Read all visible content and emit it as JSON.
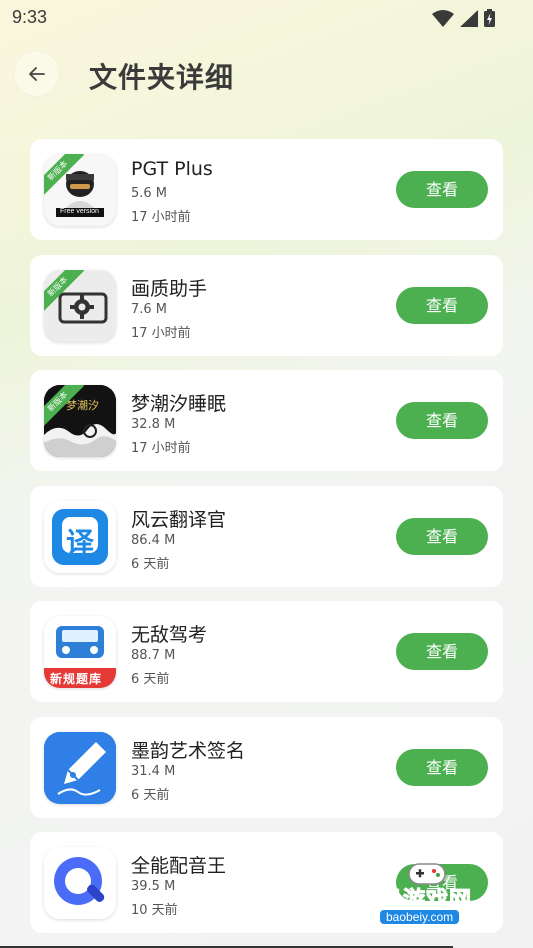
{
  "status": {
    "time": "9:33"
  },
  "header": {
    "title": "文件夹详细"
  },
  "apps": [
    {
      "name": "PGT Plus",
      "size": "5.6 M",
      "time": "17 小时前",
      "badge": "新版本",
      "icon": "pgt-plus-icon",
      "icon_caption": "Free version",
      "button": "查看"
    },
    {
      "name": "画质助手",
      "size": "7.6 M",
      "time": "17 小时前",
      "badge": "新版本",
      "icon": "gear-icon",
      "button": "查看"
    },
    {
      "name": "梦潮汐睡眠",
      "size": "32.8 M",
      "time": "17 小时前",
      "badge": "新版本",
      "icon": "wave-icon",
      "icon_caption": "梦潮汐",
      "button": "查看"
    },
    {
      "name": "风云翻译官",
      "size": "86.4 M",
      "time": "6 天前",
      "icon": "translate-icon",
      "icon_glyph": "译",
      "button": "查看"
    },
    {
      "name": "无敌驾考",
      "size": "88.7 M",
      "time": "6 天前",
      "icon": "car-icon",
      "icon_caption": "新规题库",
      "button": "查看"
    },
    {
      "name": "墨韵艺术签名",
      "size": "31.4 M",
      "time": "6 天前",
      "icon": "pen-icon",
      "button": "查看"
    },
    {
      "name": "全能配音王",
      "size": "39.5 M",
      "time": "10 天前",
      "icon": "dubbing-icon",
      "button": "查看"
    }
  ],
  "watermark": {
    "text": "宝贝游戏网",
    "url": "baobeiy.com"
  }
}
